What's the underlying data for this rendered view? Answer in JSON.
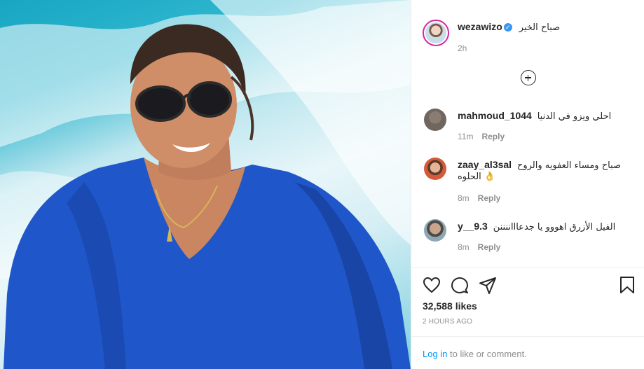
{
  "post": {
    "author": "wezawizo",
    "verified_mark": "✓",
    "caption": "صباح الخير",
    "caption_time": "2h",
    "load_more_icon": "plus-circle-icon"
  },
  "comments": [
    {
      "username": "mahmoud_1044",
      "text": "احلي ويزو في الدنيا",
      "time": "11m",
      "reply": "Reply"
    },
    {
      "username": "zaay_al3sal",
      "text": "صباح ومساء العفويه والروح",
      "text_line2": "الحلوه 👌",
      "time": "8m",
      "reply": "Reply"
    },
    {
      "username": "y__9.3",
      "text": "الفيل الأزرق اهووو يا جدعاااننننن",
      "time": "8m",
      "reply": "Reply"
    }
  ],
  "actions": {
    "like_icon": "heart-icon",
    "comment_icon": "comment-icon",
    "share_icon": "share-icon",
    "save_icon": "bookmark-icon"
  },
  "likes": "32,588 likes",
  "posted_ago": "2 HOURS AGO",
  "login": {
    "link": "Log in",
    "rest": " to like or comment."
  },
  "colors": {
    "link": "#0095f6",
    "verified": "#3897f0",
    "secondary_text": "#8e8e8e",
    "shirt": "#1f56c9",
    "sea": "#2fb6cf"
  }
}
